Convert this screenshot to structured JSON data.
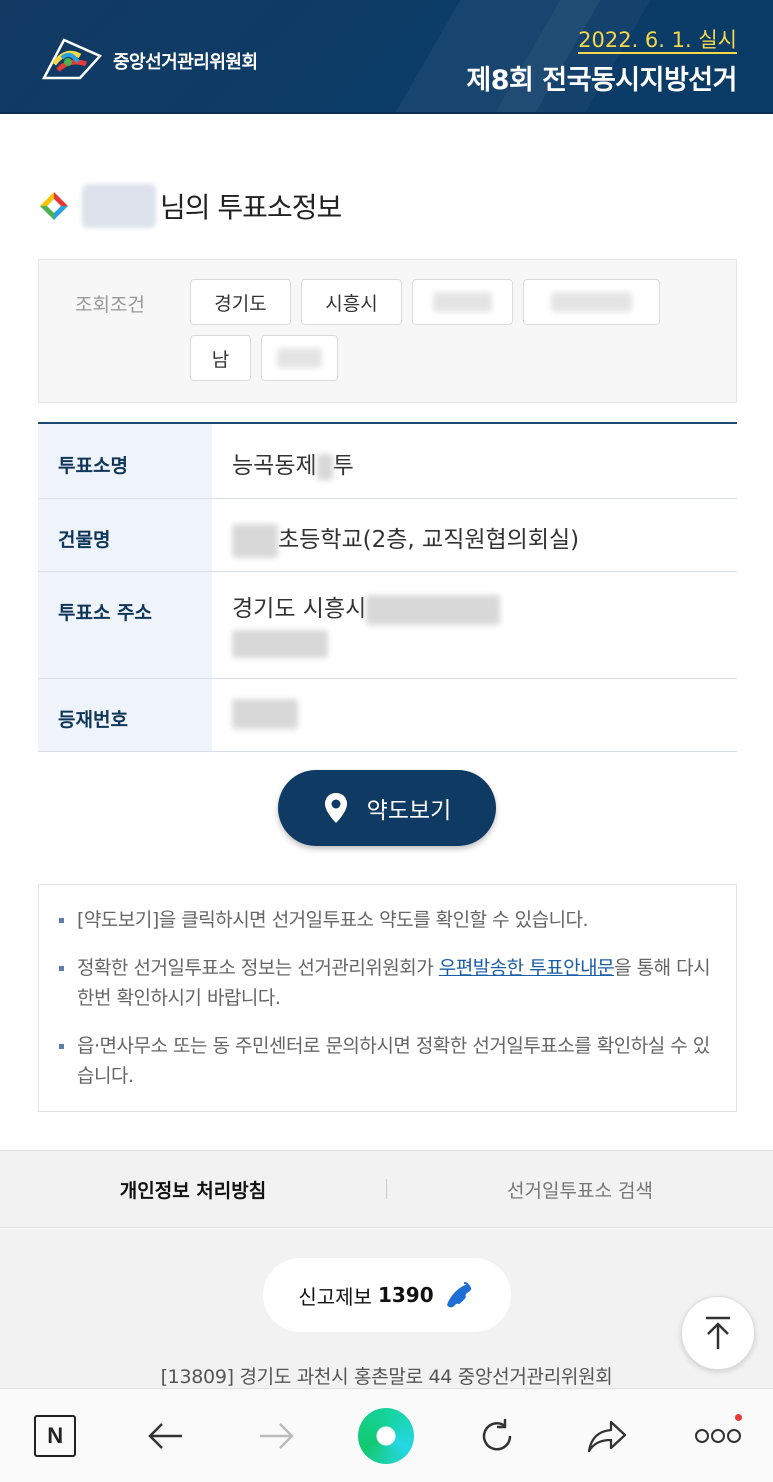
{
  "header": {
    "org_name": "중앙선거관리위원회",
    "election_date": "2022. 6. 1. 실시",
    "election_title": "제8회 전국동시지방선거"
  },
  "title": {
    "suffix": "님의 투표소정보"
  },
  "filter": {
    "label": "조회조건",
    "chips": [
      "경기도",
      "시흥시",
      "남"
    ]
  },
  "info": {
    "rows": [
      {
        "head": "투표소명",
        "value_visible": "능곡동제",
        "value_tail": "투"
      },
      {
        "head": "건물명",
        "value_visible": "초등학교(2층, 교직원협의회실)"
      },
      {
        "head": "투표소 주소",
        "value_visible": "경기도 시흥시"
      },
      {
        "head": "등재번호",
        "value_visible": ""
      }
    ]
  },
  "map_button": {
    "label": "약도보기"
  },
  "notes": {
    "items": [
      "[약도보기]을 클릭하시면 선거일투표소 약도를 확인할 수 있습니다.",
      "읍·면사무소 또는 동 주민센터로 문의하시면 정확한 선거일투표소를 확인하실 수 있습니다."
    ],
    "note2_prefix": "정확한 선거일투표소 정보는 선거관리위원회가 ",
    "note2_link": "우편발송한 투표안내문",
    "note2_suffix": "을 통해 다시한번 확인하시기 바랍니다."
  },
  "footer": {
    "links": [
      "개인정보 처리방침",
      "선거일투표소 검색"
    ],
    "report_label": "신고제보",
    "report_number": "1390",
    "address": "[13809] 경기도 과천시 홍촌말로 44 중앙선거관리위원회"
  },
  "browser_bar": {
    "n_label": "N"
  },
  "colors": {
    "header_bg": "#0c3c68",
    "accent_yellow": "#f5d94a",
    "button_navy": "#0f3a63",
    "link_blue": "#1a5ea8"
  }
}
